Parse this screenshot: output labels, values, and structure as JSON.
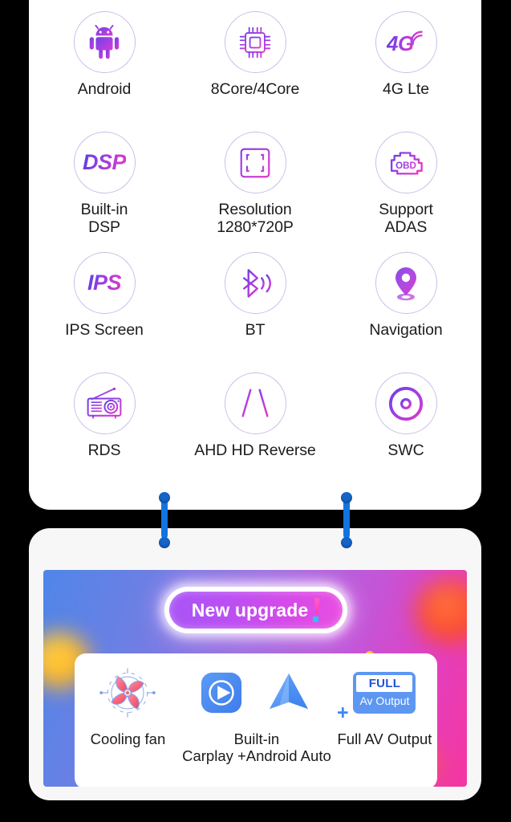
{
  "colors": {
    "card_bg": "#ffffff",
    "page_bg": "#000000",
    "icon_ring": "#c6bfe6",
    "gradient_purple": "#9b3fe0",
    "gradient_magenta": "#e038c8",
    "connector_blue": "#1274e0",
    "accent_blue": "#5d97f2",
    "banner_from": "#4f86e8",
    "banner_to": "#f5369f",
    "pill_from": "#a855f7",
    "pill_to": "#e94fe0",
    "bang_pink": "#ff3bb5",
    "bang_dot_cyan": "#1fc8f5",
    "blob_yellow": "#ffb21e",
    "blob_red": "#fa4527",
    "label_text": "#1c1c1c"
  },
  "features_card": {
    "items": [
      {
        "icon": "android-robot-icon",
        "label": "Android",
        "glyph": "",
        "wide": true
      },
      {
        "icon": "cpu-chip-icon",
        "label": "8Core/4Core",
        "glyph": "",
        "wide": true
      },
      {
        "icon": "4g-signal-icon",
        "label": "4G Lte",
        "glyph": "4G",
        "wide": true
      },
      {
        "icon": "dsp-text-icon",
        "label": "Built-in\nDSP",
        "glyph": "DSP",
        "wide": false
      },
      {
        "icon": "resolution-frame-icon",
        "label": "Resolution\n1280*720P",
        "glyph": "",
        "wide": false
      },
      {
        "icon": "obd-engine-icon",
        "label": "Support\nADAS",
        "glyph": "",
        "wide": false
      },
      {
        "icon": "ips-text-icon",
        "label": "IPS Screen",
        "glyph": "IPS",
        "wide": true
      },
      {
        "icon": "bluetooth-icon",
        "label": "BT",
        "glyph": "",
        "wide": true
      },
      {
        "icon": "map-pin-icon",
        "label": "Navigation",
        "glyph": "",
        "wide": true
      },
      {
        "icon": "radio-rds-icon",
        "label": "RDS",
        "glyph": "",
        "wide": true
      },
      {
        "icon": "reverse-guidelines-icon",
        "label": "AHD HD Reverse",
        "glyph": "",
        "wide": true
      },
      {
        "icon": "steering-wheel-icon",
        "label": "SWC",
        "glyph": "",
        "wide": true
      }
    ]
  },
  "upgrade_card": {
    "badge_text": "New upgrade",
    "badge_exclamation": "!",
    "items": [
      {
        "icon": "cooling-fan-icon",
        "label": "Cooling fan"
      },
      {
        "icon": "carplay-play-icon",
        "label": "Built-in\nCarplay +Android Auto"
      },
      {
        "icon": "android-auto-icon",
        "label": ""
      },
      {
        "icon": "full-av-badge-icon",
        "label": "Full AV Output"
      }
    ],
    "plus_separator": "+",
    "av_badge": {
      "title": "FULL",
      "subtitle": "Av Output"
    }
  }
}
